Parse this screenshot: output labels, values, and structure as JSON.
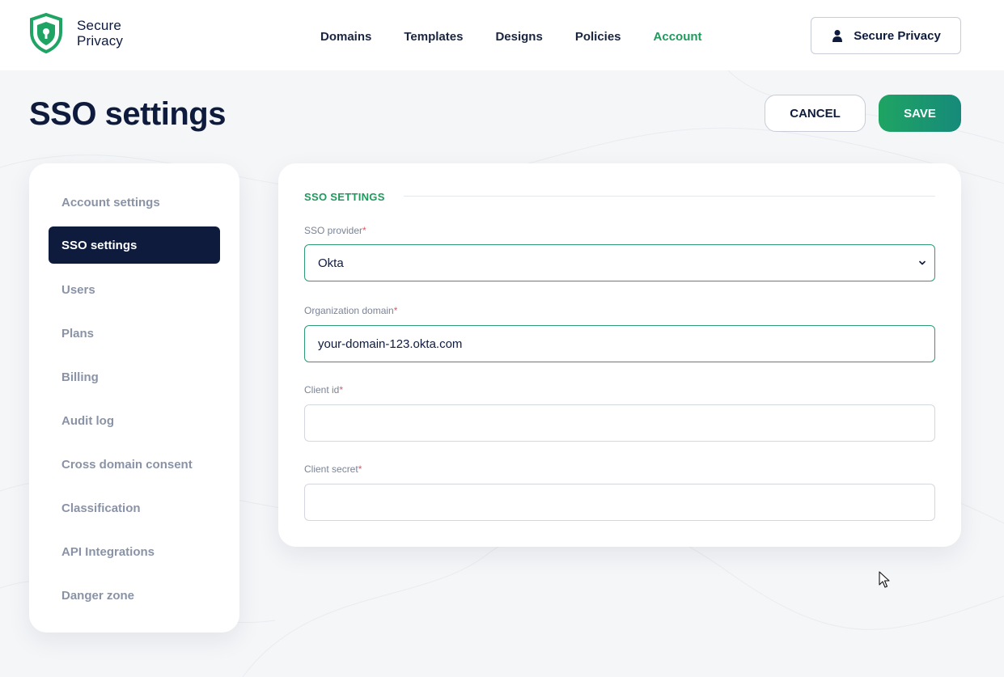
{
  "brand": {
    "line1": "Secure",
    "line2": "Privacy",
    "accent": "#1f9a5c",
    "navy": "#0e1b3d"
  },
  "nav": {
    "items": [
      {
        "label": "Domains",
        "active": false
      },
      {
        "label": "Templates",
        "active": false
      },
      {
        "label": "Designs",
        "active": false
      },
      {
        "label": "Policies",
        "active": false
      },
      {
        "label": "Account",
        "active": true
      }
    ]
  },
  "user": {
    "label": "Secure Privacy",
    "icon": "user-icon"
  },
  "page": {
    "title": "SSO settings"
  },
  "actions": {
    "cancel_label": "CANCEL",
    "save_label": "SAVE"
  },
  "sidebar": {
    "items": [
      {
        "label": "Account settings",
        "active": false
      },
      {
        "label": "SSO settings",
        "active": true
      },
      {
        "label": "Users",
        "active": false
      },
      {
        "label": "Plans",
        "active": false
      },
      {
        "label": "Billing",
        "active": false
      },
      {
        "label": "Audit log",
        "active": false
      },
      {
        "label": "Cross domain consent",
        "active": false
      },
      {
        "label": "Classification",
        "active": false
      },
      {
        "label": "API Integrations",
        "active": false
      },
      {
        "label": "Danger zone",
        "active": false
      }
    ]
  },
  "form": {
    "section_title": "SSO SETTINGS",
    "required_mark": "*",
    "provider": {
      "label": "SSO provider",
      "value": "Okta",
      "icon": "chevron-down-icon"
    },
    "domain": {
      "label": "Organization domain",
      "value": "your-domain-123.okta.com"
    },
    "client_id": {
      "label": "Client id",
      "value": ""
    },
    "client_secret": {
      "label": "Client secret",
      "value": ""
    }
  }
}
